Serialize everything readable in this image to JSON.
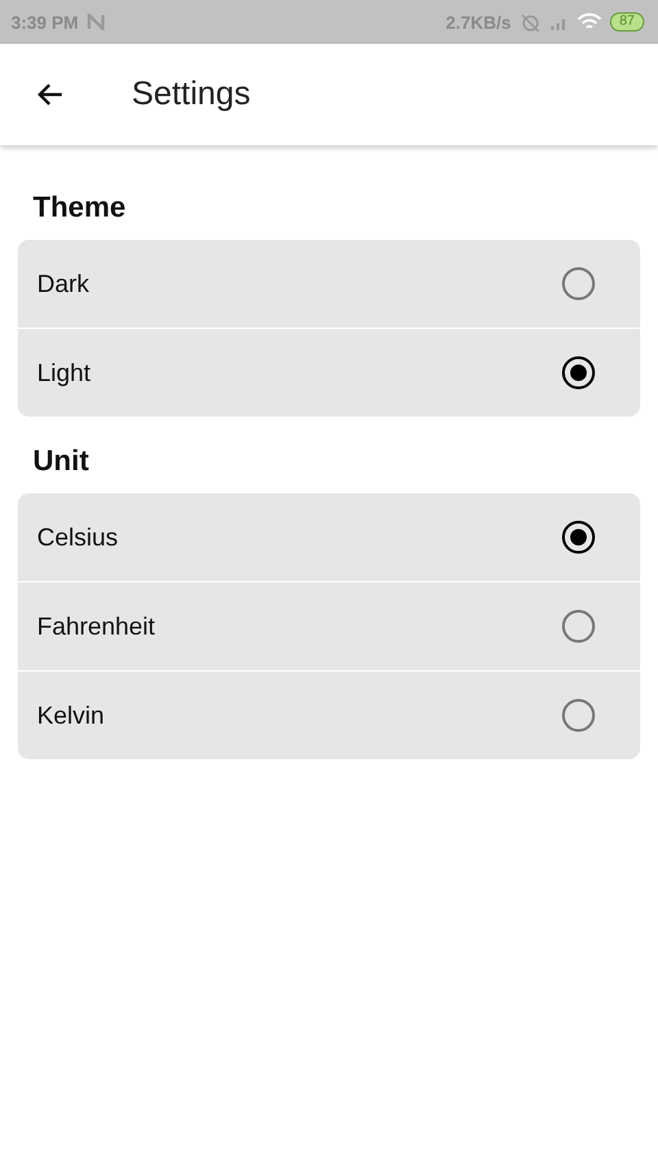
{
  "status_bar": {
    "time": "3:39 PM",
    "network_speed": "2.7KB/s",
    "battery": "87"
  },
  "app_bar": {
    "title": "Settings"
  },
  "sections": [
    {
      "title": "Theme",
      "options": [
        {
          "label": "Dark",
          "selected": false
        },
        {
          "label": "Light",
          "selected": true
        }
      ]
    },
    {
      "title": "Unit",
      "options": [
        {
          "label": "Celsius",
          "selected": true
        },
        {
          "label": "Fahrenheit",
          "selected": false
        },
        {
          "label": "Kelvin",
          "selected": false
        }
      ]
    }
  ]
}
